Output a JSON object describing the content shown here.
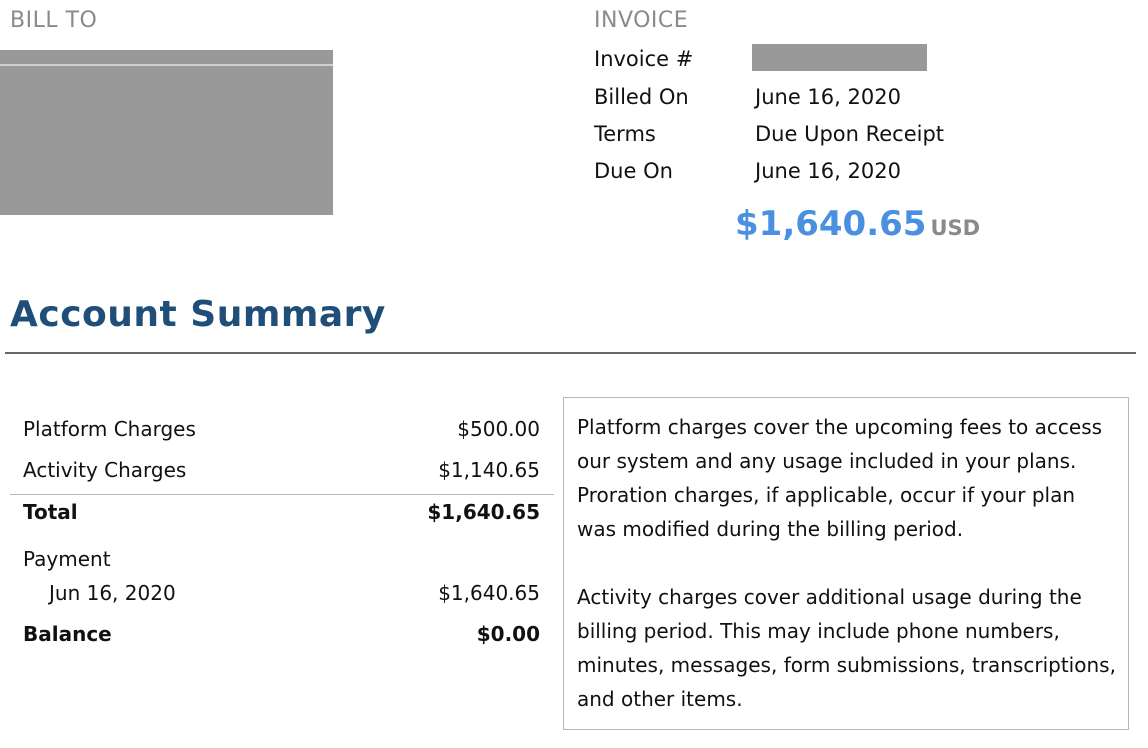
{
  "bill_to": {
    "heading": "BILL TO"
  },
  "invoice": {
    "heading": "INVOICE",
    "fields": [
      {
        "label": "Invoice #",
        "value": ""
      },
      {
        "label": "Billed On",
        "value": "June 16, 2020"
      },
      {
        "label": "Terms",
        "value": "Due Upon Receipt"
      },
      {
        "label": "Due On",
        "value": "June 16, 2020"
      }
    ],
    "amount": "$1,640.65",
    "currency": "USD",
    "amount_color": "#4a8fe0"
  },
  "summary": {
    "title": "Account Summary",
    "title_color": "#1f4e79",
    "rows": {
      "platform": {
        "label": "Platform Charges",
        "value": "$500.00"
      },
      "activity": {
        "label": "Activity Charges",
        "value": "$1,140.65"
      },
      "total": {
        "label": "Total",
        "value": "$1,640.65"
      },
      "payment": {
        "label": "Payment"
      },
      "payment_entry": {
        "label": "Jun 16, 2020",
        "value": "$1,640.65"
      },
      "balance": {
        "label": "Balance",
        "value": "$0.00"
      }
    },
    "notes": {
      "platform": "Platform charges cover the upcoming fees to access our system and any usage included in your plans. Proration charges, if applicable, occur if your plan was modified during the billing period.",
      "activity": "Activity charges cover additional usage during the billing period. This may include phone numbers, minutes, messages, form submissions, transcriptions, and other items."
    }
  }
}
